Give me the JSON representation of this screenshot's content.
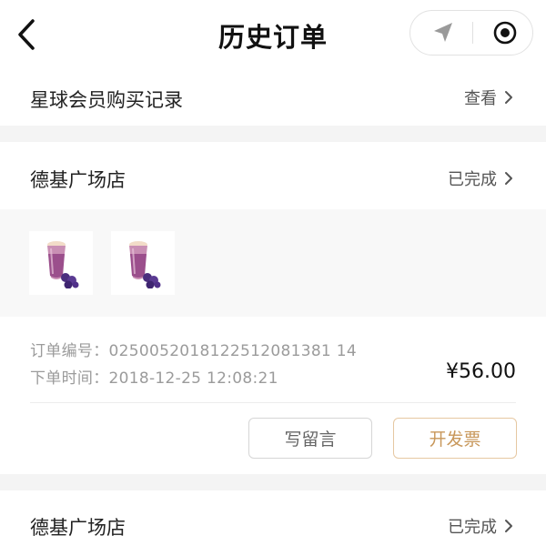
{
  "header": {
    "title": "历史订单",
    "back_icon": "chevron-left-icon",
    "capsule_icons": [
      "navigation-arrow-icon",
      "target-icon"
    ]
  },
  "membership_row": {
    "label": "星球会员购买记录",
    "action": "查看"
  },
  "orders": [
    {
      "store": "德基广场店",
      "status": "已完成",
      "products": [
        {
          "icon": "purple-drink-cup-icon"
        },
        {
          "icon": "purple-drink-cup-icon"
        }
      ],
      "order_number_label": "订单编号：",
      "order_number": "0250052018122512081381 14",
      "order_time_label": "下单时间：",
      "order_time": "2018-12-25 12:08:21",
      "price": "¥56.00",
      "buttons": {
        "message": "写留言",
        "invoice": "开发票"
      }
    },
    {
      "store": "德基广场店",
      "status": "已完成"
    }
  ],
  "colors": {
    "accent_gold": "#c8975a",
    "section_gray": "#f4f4f4",
    "muted_text": "#9b9b9b"
  }
}
